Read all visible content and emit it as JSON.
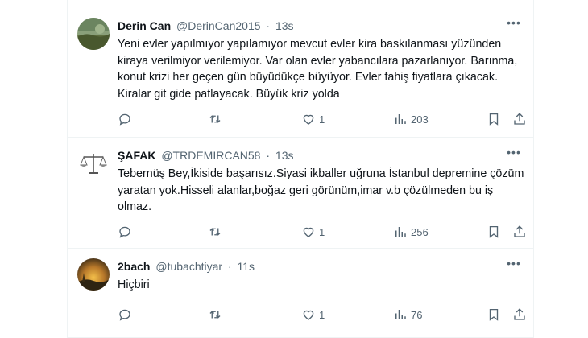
{
  "tweets": [
    {
      "name": "Derin Can",
      "handle": "@DerinCan2015",
      "time": "13s",
      "text": "Yeni evler yapılmıyor yapılamıyor mevcut evler kira baskılanması  yüzünden kiraya verilmiyor verilemiyor. Var olan evler yabancılara pazarlanıyor. Barınma, konut krizi her geçen gün büyüdükçe büyüyor. Evler fahiş fiyatlara çıkacak. Kiralar git gide patlayacak. Büyük kriz yolda",
      "replies": "",
      "retweets": "",
      "likes": "1",
      "views": "203"
    },
    {
      "name": "ŞAFAK",
      "handle": "@TRDEMIRCAN58",
      "time": "13s",
      "text": "Tebernüş Bey,İkiside başarısız.Siyasi ikballer uğruna İstanbul depremine çözüm yaratan yok.Hisseli alanlar,boğaz geri görünüm,imar v.b çözülmeden bu iş olmaz.",
      "replies": "",
      "retweets": "",
      "likes": "1",
      "views": "256"
    },
    {
      "name": "2bach",
      "handle": "@tubachtiyar",
      "time": "11s",
      "text": "Hiçbiri",
      "replies": "",
      "retweets": "",
      "likes": "1",
      "views": "76"
    }
  ],
  "icons": {
    "reply": "reply-icon",
    "retweet": "retweet-icon",
    "like": "heart-icon",
    "views": "views-chart-icon",
    "bookmark": "bookmark-icon",
    "share": "share-icon",
    "more": "more-dots-icon"
  },
  "colors": {
    "text": "#0f1419",
    "muted": "#536471",
    "divider": "#eff3f4"
  }
}
